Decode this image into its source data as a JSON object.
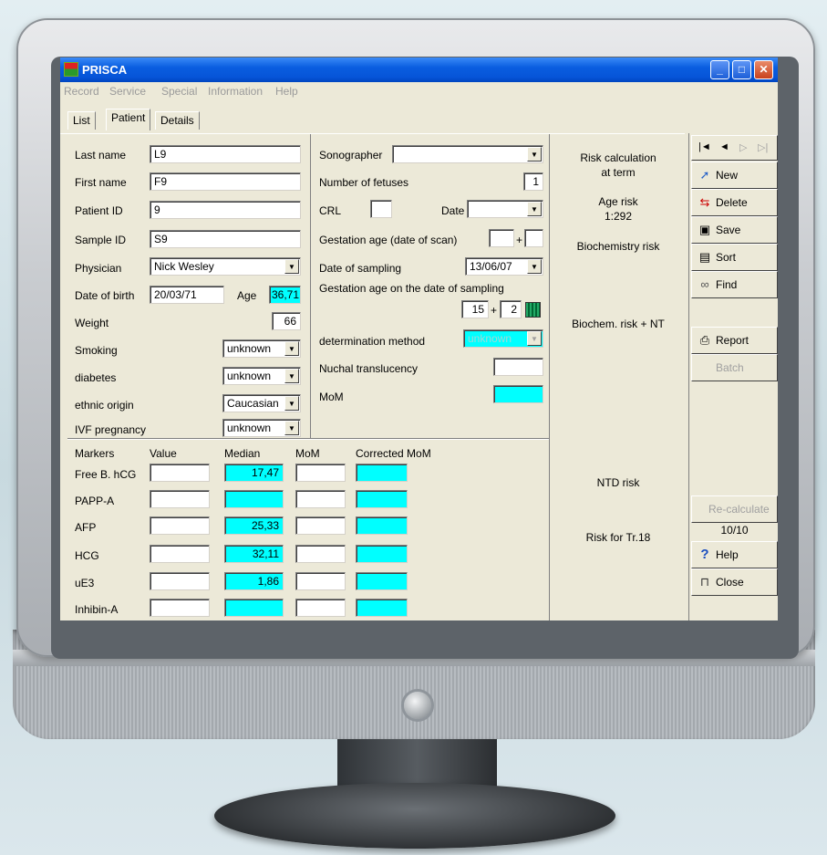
{
  "window": {
    "title": "PRISCA",
    "min": "_",
    "max": "□",
    "close": "✕"
  },
  "menu": [
    "Record",
    "Service",
    "Special",
    "Information",
    "Help"
  ],
  "tabs": [
    "List",
    "Patient",
    "Details"
  ],
  "patient": {
    "last_name_label": "Last name",
    "last_name": "L9",
    "first_name_label": "First name",
    "first_name": "F9",
    "patient_id_label": "Patient ID",
    "patient_id": "9",
    "sample_id_label": "Sample ID",
    "sample_id": "S9",
    "physician_label": "Physician",
    "physician": "Nick Wesley",
    "dob_label": "Date of birth",
    "dob": "20/03/71",
    "age_label": "Age",
    "age": "36,71",
    "weight_label": "Weight",
    "weight": "66",
    "smoking_label": "Smoking",
    "smoking": "unknown",
    "diabetes_label": "diabetes",
    "diabetes": "unknown",
    "ethnic_label": "ethnic origin",
    "ethnic": "Caucasian",
    "ivf_label": "IVF pregnancy",
    "ivf": "unknown"
  },
  "scan": {
    "sonographer_label": "Sonographer",
    "sonographer": "",
    "fetuses_label": "Number of fetuses",
    "fetuses": "1",
    "crl_label": "CRL",
    "crl": "",
    "date_label": "Date",
    "date": "",
    "ga_scan_label": "Gestation age (date of scan)",
    "ga_scan_plus": "+",
    "sampling_label": "Date of sampling",
    "sampling": "13/06/07",
    "ga_sampling_label": "Gestation age on the date of sampling",
    "ga_weeks": "15",
    "ga_plus": "+",
    "ga_days": "2",
    "method_label": "determination method",
    "method": "unknown",
    "nt_label": "Nuchal translucency",
    "nt": "",
    "mom_label": "MoM",
    "mom": ""
  },
  "markers": {
    "headers": [
      "Markers",
      "Value",
      "Median",
      "MoM",
      "Corrected MoM"
    ],
    "rows": [
      {
        "name": "Free B. hCG",
        "value": "",
        "median": "17,47",
        "mom": ""
      },
      {
        "name": "PAPP-A",
        "value": "",
        "median": "",
        "mom": ""
      },
      {
        "name": "AFP",
        "value": "",
        "median": "25,33",
        "mom": ""
      },
      {
        "name": "HCG",
        "value": "",
        "median": "32,11",
        "mom": ""
      },
      {
        "name": "uE3",
        "value": "",
        "median": "1,86",
        "mom": ""
      },
      {
        "name": "Inhibin-A",
        "value": "",
        "median": "",
        "mom": ""
      }
    ]
  },
  "risk": {
    "calc": "Risk calculation",
    "at_term": "at term",
    "age_risk_label": "Age risk",
    "age_risk": "1:292",
    "biochem": "Biochemistry risk",
    "biochem_nt": "Biochem. risk + NT",
    "ntd": "NTD risk",
    "tr18": "Risk for Tr.18"
  },
  "nav": {
    "first": "|◄",
    "prev": "◄",
    "next": "▷",
    "last": "▷|",
    "new": "New",
    "delete": "Delete",
    "save": "Save",
    "sort": "Sort",
    "find": "Find",
    "report": "Report",
    "batch": "Batch",
    "recalc": "Re-calculate",
    "counter": "10/10",
    "help": "Help",
    "close": "Close"
  },
  "colors": {
    "title_bar": "#0654d8",
    "field_highlight": "#00ffff",
    "window_bg": "#ece9d8"
  }
}
